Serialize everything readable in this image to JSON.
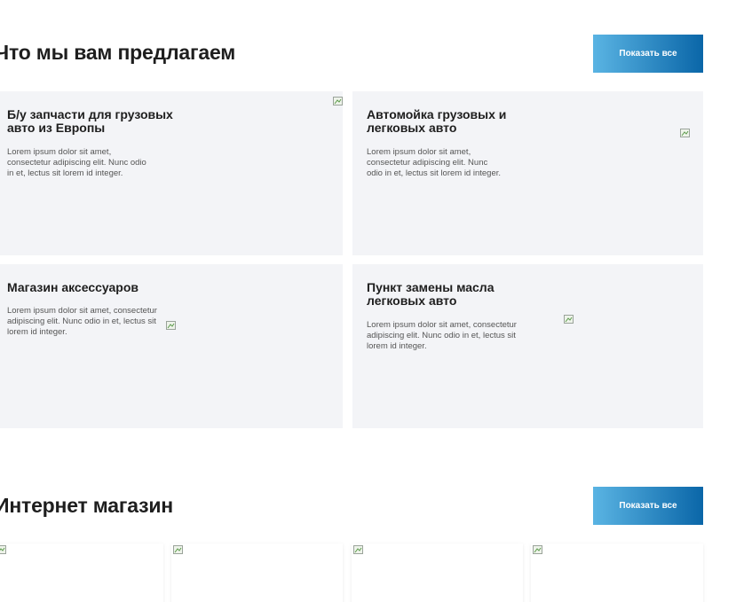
{
  "offers": {
    "title": "Что мы вам предлагаем",
    "show_all": "Показать все",
    "cards": [
      {
        "title_line1": "Б/у запчасти для грузовых",
        "title_line2": "авто из Европы",
        "text_line1": "Lorem ipsum dolor sit amet,",
        "text_line2": "consectetur adipiscing elit. Nunc odio",
        "text_line3": "in et, lectus sit lorem id integer."
      },
      {
        "title_line1": "Автомойка грузовых и",
        "title_line2": "легковых авто",
        "text_line1": "Lorem ipsum dolor sit amet,",
        "text_line2": "consectetur adipiscing elit. Nunc",
        "text_line3": "odio in et, lectus sit lorem id integer."
      },
      {
        "title_line1": "Магазин аксессуаров",
        "text_line1": "Lorem ipsum dolor sit amet, consectetur",
        "text_line2": "adipiscing elit. Nunc odio in et, lectus sit",
        "text_line3": "lorem id integer."
      },
      {
        "title_line1": "Пункт замены масла",
        "title_line2": "легковых авто",
        "text_line1": "Lorem ipsum dolor sit amet, consectetur",
        "text_line2": "adipiscing elit. Nunc odio in et, lectus sit",
        "text_line3": "lorem id integer."
      }
    ]
  },
  "shop": {
    "title": "Интернет магазин",
    "show_all": "Показать все"
  },
  "colors": {
    "card_bg": "#f3f4f7",
    "button_gradient_start": "#5ab4e3",
    "button_gradient_end": "#0a66a8"
  }
}
